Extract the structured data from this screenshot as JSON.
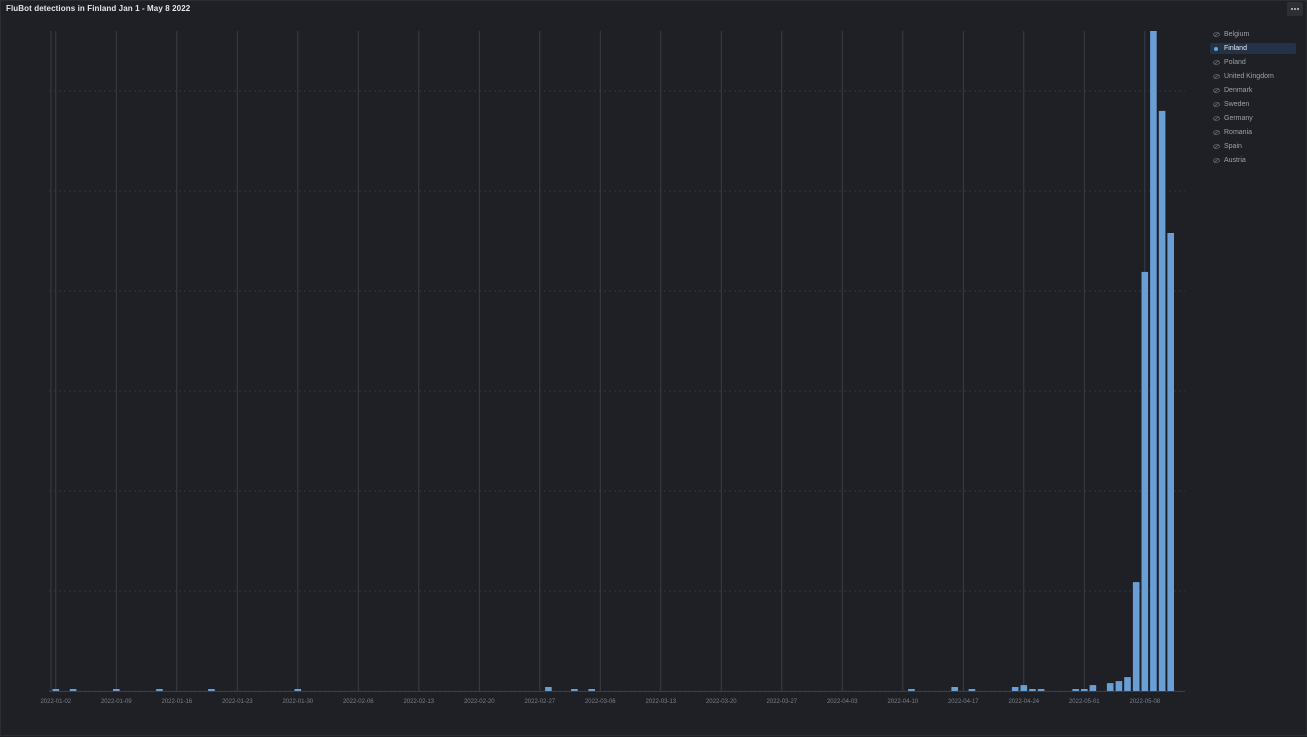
{
  "panel": {
    "title": "FluBot detections in Finland Jan 1 - May 8 2022",
    "menu_icon": "ellipsis-icon"
  },
  "legend": {
    "items": [
      {
        "label": "Belgium",
        "active": false
      },
      {
        "label": "Finland",
        "active": true
      },
      {
        "label": "Poland",
        "active": false
      },
      {
        "label": "United Kingdom",
        "active": false
      },
      {
        "label": "Denmark",
        "active": false
      },
      {
        "label": "Sweden",
        "active": false
      },
      {
        "label": "Germany",
        "active": false
      },
      {
        "label": "Romania",
        "active": false
      },
      {
        "label": "Spain",
        "active": false
      },
      {
        "label": "Austria",
        "active": false
      }
    ],
    "hidden_icon": "eye-slash-icon"
  },
  "colors": {
    "background": "#1f1f26",
    "bar": "#6a9fd6",
    "grid": "#3a3d4a",
    "active_legend_bg": "#233246"
  },
  "chart_data": {
    "type": "bar",
    "title": "FluBot detections in Finland Jan 1 - May 8 2022",
    "xlabel": "",
    "ylabel": "",
    "x_start": "2022-01-01",
    "x_end": "2022-05-08",
    "ylim": [
      0,
      100
    ],
    "grid": true,
    "legend_position": "right",
    "x_ticks": [
      "2022-01-02",
      "2022-01-09",
      "2022-01-16",
      "2022-01-23",
      "2022-01-30",
      "2022-02-06",
      "2022-02-13",
      "2022-02-20",
      "2022-02-27",
      "2022-03-06",
      "2022-03-13",
      "2022-03-20",
      "2022-03-27",
      "2022-04-03",
      "2022-04-10",
      "2022-04-17",
      "2022-04-24",
      "2022-05-01",
      "2022-05-08"
    ],
    "series": [
      {
        "name": "Finland",
        "points": [
          {
            "x": "2022-01-02",
            "y": 0.3
          },
          {
            "x": "2022-01-04",
            "y": 0.3
          },
          {
            "x": "2022-01-09",
            "y": 0.3
          },
          {
            "x": "2022-01-14",
            "y": 0.3
          },
          {
            "x": "2022-01-20",
            "y": 0.3
          },
          {
            "x": "2022-01-30",
            "y": 0.3
          },
          {
            "x": "2022-02-28",
            "y": 0.6
          },
          {
            "x": "2022-03-03",
            "y": 0.3
          },
          {
            "x": "2022-03-05",
            "y": 0.3
          },
          {
            "x": "2022-04-11",
            "y": 0.3
          },
          {
            "x": "2022-04-16",
            "y": 0.6
          },
          {
            "x": "2022-04-18",
            "y": 0.3
          },
          {
            "x": "2022-04-23",
            "y": 0.6
          },
          {
            "x": "2022-04-24",
            "y": 0.9
          },
          {
            "x": "2022-04-25",
            "y": 0.3
          },
          {
            "x": "2022-04-26",
            "y": 0.3
          },
          {
            "x": "2022-04-30",
            "y": 0.3
          },
          {
            "x": "2022-05-01",
            "y": 0.3
          },
          {
            "x": "2022-05-02",
            "y": 0.9
          },
          {
            "x": "2022-05-04",
            "y": 1.2
          },
          {
            "x": "2022-05-05",
            "y": 1.5
          },
          {
            "x": "2022-05-06",
            "y": 2.1
          },
          {
            "x": "2022-05-07",
            "y": 16.5
          },
          {
            "x": "2022-05-08",
            "y": 63.5
          },
          {
            "x": "2022-05-09",
            "y": 100
          },
          {
            "x": "2022-05-10",
            "y": 87.9
          },
          {
            "x": "2022-05-11",
            "y": 69.4
          }
        ]
      }
    ]
  }
}
